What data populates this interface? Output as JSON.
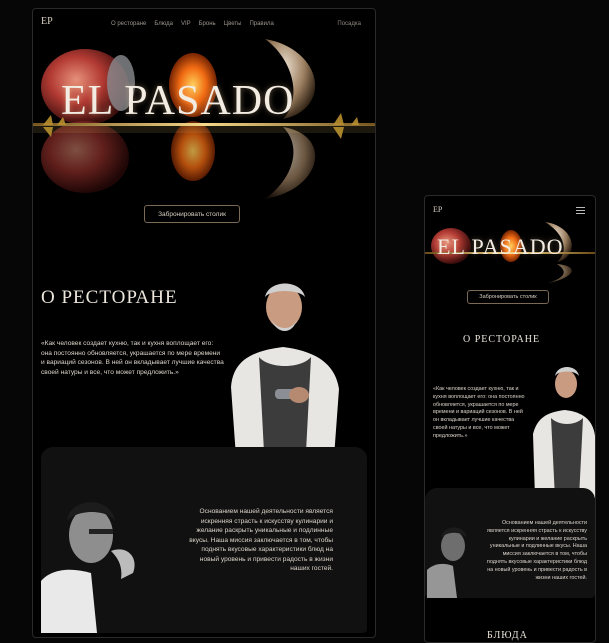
{
  "brand": {
    "logo": "ЕР"
  },
  "desktop": {
    "nav": {
      "items": [
        "О ресторане",
        "Блюда",
        "VIP",
        "Бронь",
        "Цветы",
        "Правила"
      ],
      "login": "Посадка"
    },
    "hero": {
      "title": "EL PASADO",
      "cta": "Забронировать столик"
    },
    "about": {
      "title": "О РЕСТОРАНЕ",
      "quote": "«Как человек создает кухню, так и кухня воплощает его: она постоянно обновляется, украшается по мере времени и вариаций сезонов. В ней он вкладывает лучшие качества своей натуры и все, что может предложить.»"
    },
    "mission": {
      "text": "Основанием нашей деятельности является искренняя страсть к искусству кулинарии и желание раскрыть уникальные и подлинные вкусы. Наша миссия заключается в том, чтобы поднять вкусовые характеристики блюд на новый уровень и привести радость в жизни наших гостей."
    }
  },
  "mobile": {
    "hero": {
      "title": "EL PASADO",
      "cta": "Забронировать столик"
    },
    "about": {
      "title": "О РЕСТОРАНЕ",
      "quote": "«Как человек создает кухню, так и кухня воплощает его: она постоянно обновляется, украшается по мере времени и вариаций сезонов. В ней он вкладывает лучшие качества своей натуры и все, что может предложить.»"
    },
    "mission": {
      "text": "Основанием нашей деятельности является искренняя страсть к искусству кулинарии и желание раскрыть уникальные и подлинные вкусы. Наша миссия заключается в том, чтобы поднять вкусовые характеристики блюд на новый уровень и привести радость в жизни наших гостей."
    },
    "next_section": "БЛЮДА"
  },
  "colors": {
    "background": "#000000",
    "accent": "#c9a46a",
    "text": "#e8e2d8"
  }
}
